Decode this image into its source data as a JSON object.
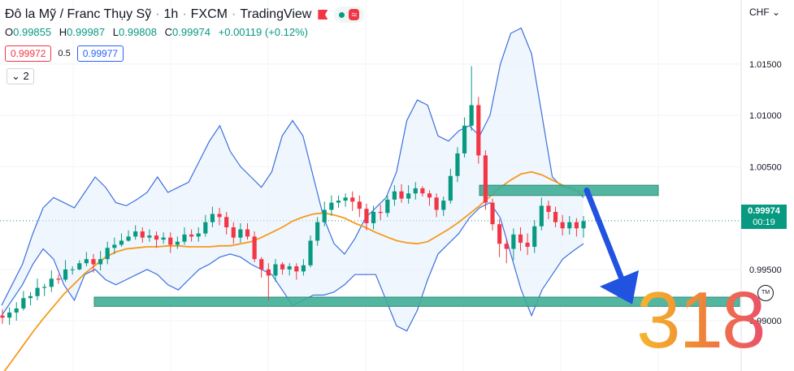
{
  "header": {
    "symbol_name": "Đô la Mỹ / Franc Thụy Sỹ",
    "interval": "1h",
    "exchange": "FXCM",
    "source": "TradingView",
    "sep": "·"
  },
  "ohlc": {
    "o_label": "O",
    "o_value": "0.99855",
    "h_label": "H",
    "h_value": "0.99987",
    "l_label": "L",
    "l_value": "0.99808",
    "c_label": "C",
    "c_value": "0.99974",
    "change": "+0.00119 (+0.12%)"
  },
  "quote": {
    "sell": "0.99972",
    "spread": "0.5",
    "buy": "0.99977"
  },
  "indicators_toggle": {
    "count": "2"
  },
  "currency": "CHF",
  "last_price": {
    "value": "0.99974",
    "countdown": "00:19"
  },
  "watermark": "318",
  "colors": {
    "bull": "#089981",
    "bear": "#f23645",
    "bands": "#3b6fe0",
    "ma": "#f59a1c",
    "zone": "#3fae97",
    "arrow": "#2152e0"
  },
  "chart_data": {
    "type": "candlestick",
    "title": "Đô la Mỹ / Franc Thụy Sỹ · 1h · FXCM",
    "y_ticks": [
      "1.01500",
      "1.01000",
      "1.00500",
      "0.99500",
      "0.99000"
    ],
    "ylim": [
      0.9855,
      1.0195
    ],
    "indicators": [
      "Bollinger Bands",
      "Moving Average"
    ],
    "zones": [
      {
        "from": 0.9914,
        "to": 0.9923
      },
      {
        "from": 1.0022,
        "to": 1.0032
      }
    ],
    "arrow": {
      "from": 1.0027,
      "to": 0.9916
    },
    "ma": [
      0.9847,
      0.9861,
      0.9875,
      0.9889,
      0.9902,
      0.9914,
      0.9926,
      0.9936,
      0.9946,
      0.9954,
      0.9962,
      0.9967,
      0.997,
      0.9971,
      0.9972,
      0.9972,
      0.9973,
      0.9973,
      0.9972,
      0.9972,
      0.9972,
      0.9973,
      0.9973,
      0.9975,
      0.9977,
      0.9981,
      0.9986,
      0.9991,
      0.9997,
      1.0001,
      1.0004,
      1.0005,
      1.0003,
      1.0,
      0.9995,
      0.9991,
      0.9986,
      0.9982,
      0.9978,
      0.9976,
      0.9975,
      0.9977,
      0.9983,
      0.9989,
      0.9996,
      1.0004,
      1.0012,
      1.0021,
      1.003,
      1.0037,
      1.0043,
      1.0045,
      1.0042,
      1.0037,
      1.0032,
      1.0027,
      1.0025
    ],
    "bb_upper": [
      0.9915,
      0.9935,
      0.9955,
      0.9985,
      1.001,
      1.002,
      1.0015,
      1.001,
      1.0025,
      1.004,
      1.003,
      1.0015,
      1.0012,
      1.0018,
      1.0025,
      1.004,
      1.0025,
      1.003,
      1.0035,
      1.0055,
      1.0075,
      1.009,
      1.0065,
      1.005,
      1.004,
      1.003,
      1.0045,
      1.008,
      1.0095,
      1.008,
      1.004,
      1.0,
      0.9975,
      0.9965,
      0.998,
      1.0,
      1.001,
      1.002,
      1.0045,
      1.0095,
      1.0115,
      1.011,
      1.008,
      1.0075,
      1.0085,
      1.009,
      1.008,
      1.01,
      1.015,
      1.018,
      1.0185,
      1.016,
      1.01,
      1.004,
      1.003,
      1.003,
      1.002
    ],
    "bb_lower": [
      0.9905,
      0.992,
      0.9935,
      0.9955,
      0.997,
      0.996,
      0.9935,
      0.992,
      0.9945,
      0.995,
      0.994,
      0.9935,
      0.994,
      0.9945,
      0.995,
      0.9945,
      0.9935,
      0.993,
      0.994,
      0.995,
      0.9955,
      0.9962,
      0.9965,
      0.9962,
      0.9955,
      0.995,
      0.9945,
      0.993,
      0.9915,
      0.992,
      0.9925,
      0.9925,
      0.9928,
      0.9935,
      0.9945,
      0.9945,
      0.9945,
      0.992,
      0.9895,
      0.989,
      0.991,
      0.994,
      0.9965,
      0.9975,
      0.9985,
      1.0,
      1.001,
      1.0015,
      1.0,
      0.9965,
      0.993,
      0.9905,
      0.993,
      0.9945,
      0.996,
      0.9968,
      0.9975
    ],
    "candles": [
      [
        0.9905,
        0.9903,
        0.9911,
        0.9897
      ],
      [
        0.9903,
        0.9908,
        0.9913,
        0.9896
      ],
      [
        0.9908,
        0.9912,
        0.9918,
        0.99
      ],
      [
        0.9912,
        0.9922,
        0.9929,
        0.991
      ],
      [
        0.9922,
        0.9924,
        0.9928,
        0.9915
      ],
      [
        0.9924,
        0.9932,
        0.9941,
        0.992
      ],
      [
        0.9932,
        0.9933,
        0.9936,
        0.9924
      ],
      [
        0.9933,
        0.9941,
        0.9949,
        0.9928
      ],
      [
        0.9941,
        0.994,
        0.9945,
        0.9936
      ],
      [
        0.994,
        0.995,
        0.9959,
        0.9938
      ],
      [
        0.995,
        0.995,
        0.9953,
        0.9945
      ],
      [
        0.995,
        0.9956,
        0.9959,
        0.9949
      ],
      [
        0.9956,
        0.996,
        0.9967,
        0.9953
      ],
      [
        0.996,
        0.9955,
        0.9965,
        0.9947
      ],
      [
        0.9955,
        0.996,
        0.9968,
        0.9949
      ],
      [
        0.996,
        0.9971,
        0.9977,
        0.9955
      ],
      [
        0.9971,
        0.9974,
        0.9981,
        0.9965
      ],
      [
        0.9974,
        0.9978,
        0.9985,
        0.9972
      ],
      [
        0.9978,
        0.9982,
        0.9988,
        0.9977
      ],
      [
        0.9982,
        0.9987,
        0.9993,
        0.9979
      ],
      [
        0.9987,
        0.9981,
        0.9991,
        0.9976
      ],
      [
        0.9981,
        0.9983,
        0.9989,
        0.9977
      ],
      [
        0.9983,
        0.9979,
        0.9987,
        0.9971
      ],
      [
        0.9979,
        0.9981,
        0.9986,
        0.9975
      ],
      [
        0.9981,
        0.9974,
        0.9986,
        0.9966
      ],
      [
        0.9974,
        0.9977,
        0.9982,
        0.997
      ],
      [
        0.9977,
        0.9984,
        0.9991,
        0.9974
      ],
      [
        0.9984,
        0.9982,
        0.9989,
        0.9977
      ],
      [
        0.9982,
        0.9985,
        0.9991,
        0.9977
      ],
      [
        0.9985,
        0.9996,
        1.0003,
        0.9982
      ],
      [
        0.9996,
        1.0004,
        1.0011,
        0.9991
      ],
      [
        1.0004,
        1.0001,
        1.001,
        0.9993
      ],
      [
        1.0001,
        0.9991,
        1.0006,
        0.9984
      ],
      [
        0.9991,
        0.9981,
        0.9996,
        0.9975
      ],
      [
        0.9981,
        0.9989,
        0.9995,
        0.9976
      ],
      [
        0.9989,
        0.9982,
        0.9995,
        0.9979
      ],
      [
        0.9982,
        0.996,
        0.9987,
        0.9957
      ],
      [
        0.996,
        0.995,
        0.9962,
        0.9942
      ],
      [
        0.995,
        0.9944,
        0.9956,
        0.992
      ],
      [
        0.9944,
        0.9955,
        0.996,
        0.9938
      ],
      [
        0.9955,
        0.995,
        0.9957,
        0.9945
      ],
      [
        0.995,
        0.9953,
        0.9956,
        0.9944
      ],
      [
        0.9953,
        0.9948,
        0.9956,
        0.994
      ],
      [
        0.9948,
        0.9954,
        0.996,
        0.9944
      ],
      [
        0.9954,
        0.9978,
        0.9983,
        0.9952
      ],
      [
        0.9978,
        0.9996,
        1.0001,
        0.9973
      ],
      [
        0.9996,
        1.0008,
        1.0016,
        0.9992
      ],
      [
        1.0008,
        1.0015,
        1.0022,
        1.0002
      ],
      [
        1.0015,
        1.0017,
        1.0022,
        1.001
      ],
      [
        1.0017,
        1.002,
        1.0024,
        1.0011
      ],
      [
        1.002,
        1.0016,
        1.0026,
        1.0007
      ],
      [
        1.0016,
        1.0009,
        1.0022,
        1.0001
      ],
      [
        1.0009,
        0.9995,
        1.0014,
        0.9988
      ],
      [
        0.9995,
        1.0006,
        1.0012,
        0.9989
      ],
      [
        1.0006,
        1.0005,
        1.0013,
        0.9998
      ],
      [
        1.0005,
        1.0018,
        1.0022,
        1.0001
      ],
      [
        1.0018,
        1.0026,
        1.0032,
        1.0012
      ],
      [
        1.0026,
        1.0019,
        1.0033,
        1.0015
      ],
      [
        1.0019,
        1.0024,
        1.0032,
        1.0014
      ],
      [
        1.0024,
        1.0029,
        1.0035,
        1.0018
      ],
      [
        1.0029,
        1.0024,
        1.0031,
        1.0021
      ],
      [
        1.0024,
        1.002,
        1.0027,
        1.0012
      ],
      [
        1.002,
        1.0008,
        1.0024,
        1.0001
      ],
      [
        1.0008,
        1.0017,
        1.0021,
        1.0002
      ],
      [
        1.0017,
        1.0041,
        1.0048,
        1.0014
      ],
      [
        1.0041,
        1.0063,
        1.0069,
        1.0035
      ],
      [
        1.0063,
        1.009,
        1.0098,
        1.0059
      ],
      [
        1.009,
        1.011,
        1.0148,
        1.0085
      ],
      [
        1.011,
        1.0061,
        1.0118,
        1.0053
      ],
      [
        1.0061,
        1.0015,
        1.0066,
        1.0008
      ],
      [
        1.0015,
        0.9994,
        1.0019,
        0.9988
      ],
      [
        0.9994,
        0.9975,
        0.9999,
        0.9962
      ],
      [
        0.9975,
        0.997,
        0.998,
        0.9956
      ],
      [
        0.997,
        0.9984,
        0.999,
        0.9959
      ],
      [
        0.9984,
        0.9976,
        0.9991,
        0.9968
      ],
      [
        0.9976,
        0.9972,
        0.9985,
        0.9964
      ],
      [
        0.9972,
        0.9992,
        0.9998,
        0.9966
      ],
      [
        0.9992,
        1.0012,
        1.002,
        0.9988
      ],
      [
        1.0012,
        1.0006,
        1.0017,
        0.9999
      ],
      [
        1.0006,
        0.9996,
        1.0011,
        0.9991
      ],
      [
        0.9996,
        0.999,
        1.0003,
        0.9983
      ],
      [
        0.999,
        0.9996,
        1.0002,
        0.9984
      ],
      [
        0.9996,
        0.999,
        1.0,
        0.9982
      ],
      [
        0.999,
        0.9997,
        1.0002,
        0.9981
      ]
    ]
  }
}
